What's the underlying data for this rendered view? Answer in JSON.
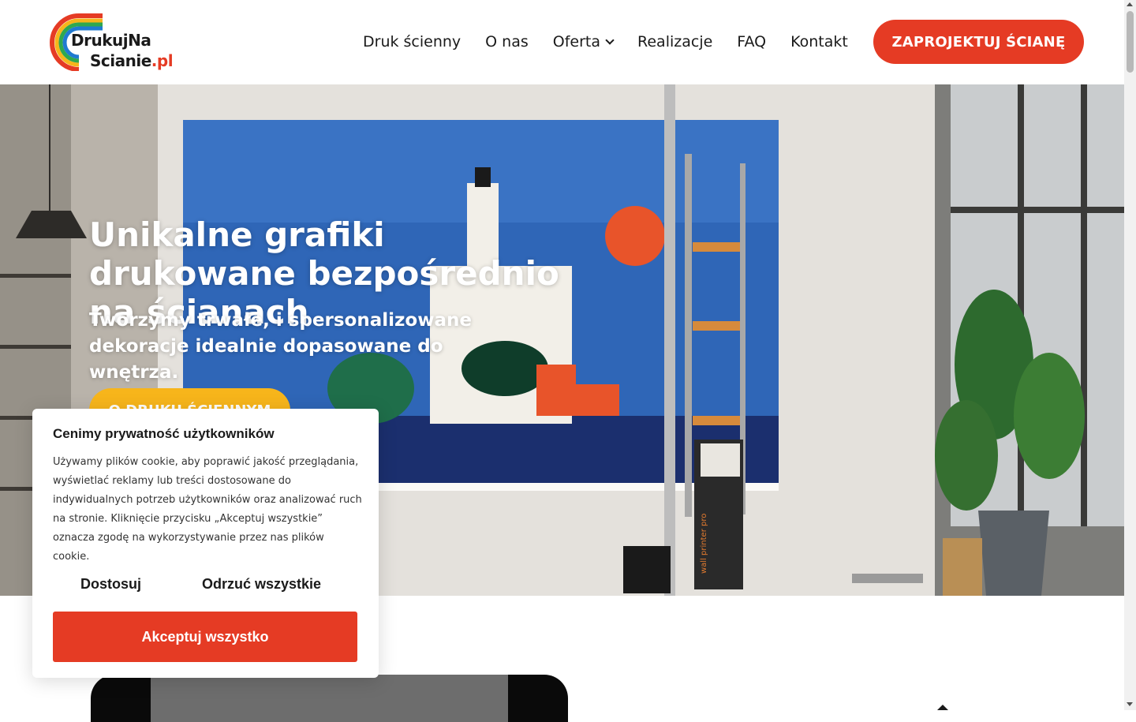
{
  "brand": {
    "logo_line1": "DrukujNa",
    "logo_line2": "Scianie",
    "logo_tld": ".pl",
    "accent_color": "#e53b24",
    "secondary_color": "#f7b51b"
  },
  "nav": {
    "items": [
      {
        "label": "Druk ścienny"
      },
      {
        "label": "O nas"
      },
      {
        "label": "Oferta",
        "icon": "chevron-down-icon"
      },
      {
        "label": "Realizacje"
      },
      {
        "label": "FAQ"
      },
      {
        "label": "Kontakt"
      }
    ],
    "cta_label": "ZAPROJEKTUJ ŚCIANĘ"
  },
  "hero": {
    "title": "Unikalne grafiki drukowane bezpośrednio na ścianach",
    "subtitle": "Tworzymy trwałe, i spersonalizowane dekoracje idealnie dopasowane do wnętrza.",
    "button_label": "O DRUKU ŚCIENNYM",
    "printer_label": "wall printer pro"
  },
  "cookie": {
    "title": "Cenimy prywatność użytkowników",
    "text": "Używamy plików cookie, aby poprawić jakość przeglądania, wyświetlać reklamy lub treści dostosowane do indywidualnych potrzeb użytkowników oraz analizować ruch na stronie. Kliknięcie przycisku „Akceptuj wszystkie” oznacza zgodę na wykorzystywanie przez nas plików cookie.",
    "customize_label": "Dostosuj",
    "reject_label": "Odrzuć wszystkie",
    "accept_label": "Akceptuj wszystko"
  }
}
